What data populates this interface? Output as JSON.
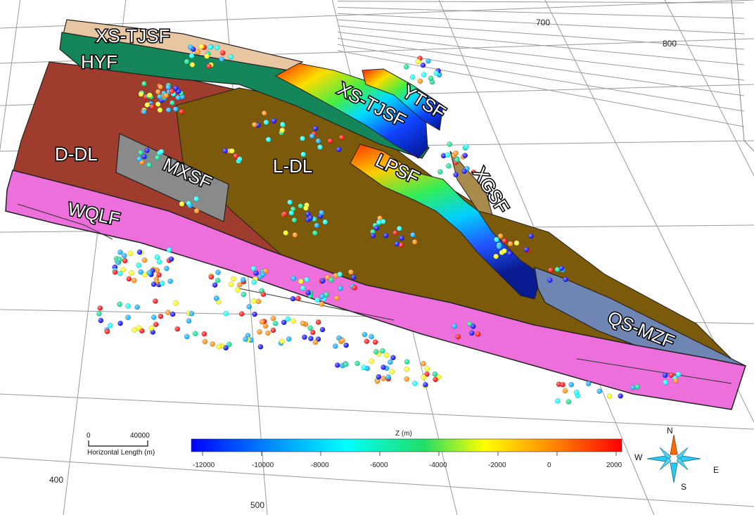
{
  "faults": {
    "xs_tjsf_top": "XS-TJSF",
    "hyf": "HYF",
    "d_dl": "D-DL",
    "mxsf": "MXSF",
    "l_dl": "L-DL",
    "xs_tjsf": "XS-TJSF",
    "ytsf": "YTSF",
    "lpsf": "LPSF",
    "xgsf": "XGSF",
    "wqlf": "WQLF",
    "qs_mzf": "QS-MZF"
  },
  "grid_labels": {
    "top_700": "700",
    "top_800": "800",
    "bottom_400": "400",
    "bottom_500": "500"
  },
  "scale_bar": {
    "zero": "0",
    "value": "40000",
    "label": "Horizontal Length (m)"
  },
  "colorbar": {
    "title": "Z (m)",
    "ticks": [
      "-12000",
      "-10000",
      "-8000",
      "-6000",
      "-4000",
      "-2000",
      "0",
      "2000"
    ],
    "colors": [
      "#0000ff",
      "#00aaff",
      "#00ffff",
      "#00dd88",
      "#ffff00",
      "#ff8800",
      "#ff0000"
    ]
  },
  "compass": {
    "n": "N",
    "s": "S",
    "e": "E",
    "w": "W"
  },
  "colors": {
    "wqlf": "#ec6fdb",
    "d_dl": "#9e3d2e",
    "l_dl": "#7c5a0b",
    "hyf": "#15855a",
    "mxsf": "#8a8a8a",
    "xs_tjsf_top": "#e8c6a2",
    "qs_mzf": "#6f86b5"
  }
}
